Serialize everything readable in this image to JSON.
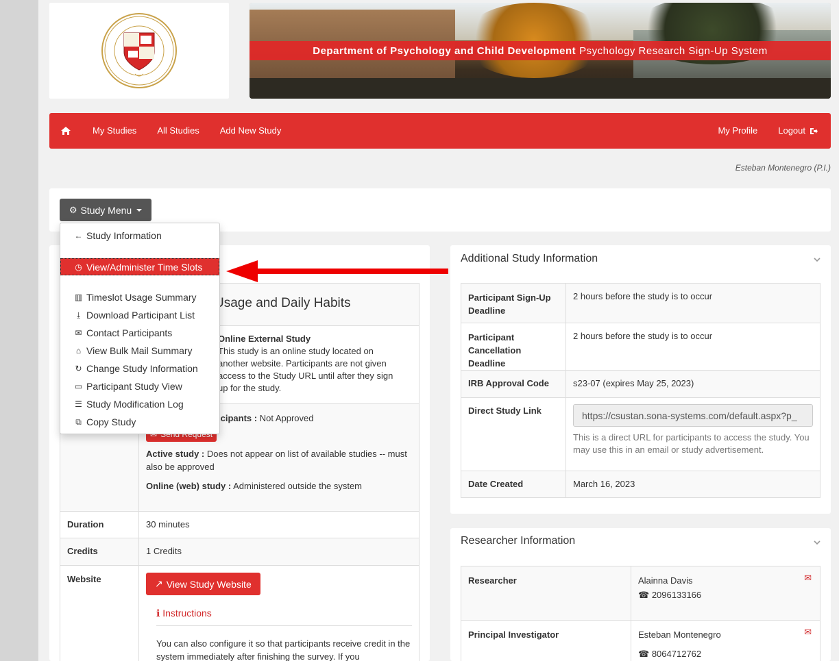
{
  "banner": {
    "dept": "Department of Psychology and Child Development",
    "system": "Psychology Research Sign-Up System",
    "seal_top_text": "CALIFORNIA STATE UNIVERSITY",
    "seal_bottom_text": "STANISLAUS",
    "seal_motto": "VOX VERITAS VITA"
  },
  "nav": {
    "items": [
      "My Studies",
      "All Studies",
      "Add New Study"
    ],
    "profile": "My Profile",
    "logout": "Logout"
  },
  "user": "Esteban Montenegro (P.I.)",
  "study_menu": {
    "button": "Study Menu",
    "items": {
      "info": "Study Information",
      "timeslots": "View/Administer Time Slots",
      "usage": "Timeslot Usage Summary",
      "download": "Download Participant List",
      "contact": "Contact Participants",
      "bulk": "View Bulk Mail Summary",
      "change": "Change Study Information",
      "participant_view": "Participant Study View",
      "log": "Study Modification Log",
      "copy": "Copy Study"
    }
  },
  "study": {
    "title_visible": "Usage and Daily Habits",
    "type_title": "Online External Study",
    "type_desc": "This study is an online study located on another website. Participants are not given access to the Study URL until after they sign up for the study.",
    "approval_label": "icipants :",
    "approval_value": "Not Approved",
    "send_request": "Send Request",
    "active_label": "Active study :",
    "active_value": "Does not appear on list of available studies -- must also be approved",
    "online_label": "Online (web) study :",
    "online_value": "Administered outside the system",
    "duration_label": "Duration",
    "duration_value": "30 minutes",
    "credits_label": "Credits",
    "credits_value": "1 Credits",
    "website_label": "Website",
    "website_button": "View Study Website",
    "instructions": "Instructions",
    "instructions_text": "You can also configure it so that participants receive credit in the system immediately after finishing the survey. If you"
  },
  "additional": {
    "title": "Additional Study Information",
    "rows": {
      "signup_label": "Participant Sign-Up Deadline",
      "signup_value": "2 hours before the study is to occur",
      "cancel_label": "Participant Cancellation Deadline",
      "cancel_value": "2 hours before the study is to occur",
      "irb_label": "IRB Approval Code",
      "irb_value": "s23-07 (expires May 25, 2023)",
      "link_label": "Direct Study Link",
      "link_value": "https://csustan.sona-systems.com/default.aspx?p_",
      "link_help": "This is a direct URL for participants to access the study. You may use this in an email or study advertisement.",
      "created_label": "Date Created",
      "created_value": "March 16, 2023"
    }
  },
  "researcher": {
    "title": "Researcher Information",
    "researcher_label": "Researcher",
    "researcher_name": "Alainna Davis",
    "researcher_phone": "2096133166",
    "pi_label": "Principal Investigator",
    "pi_name": "Esteban Montenegro",
    "pi_phone": "8064712762"
  },
  "colors": {
    "accent": "#e0302e",
    "menu_button": "#555555"
  }
}
